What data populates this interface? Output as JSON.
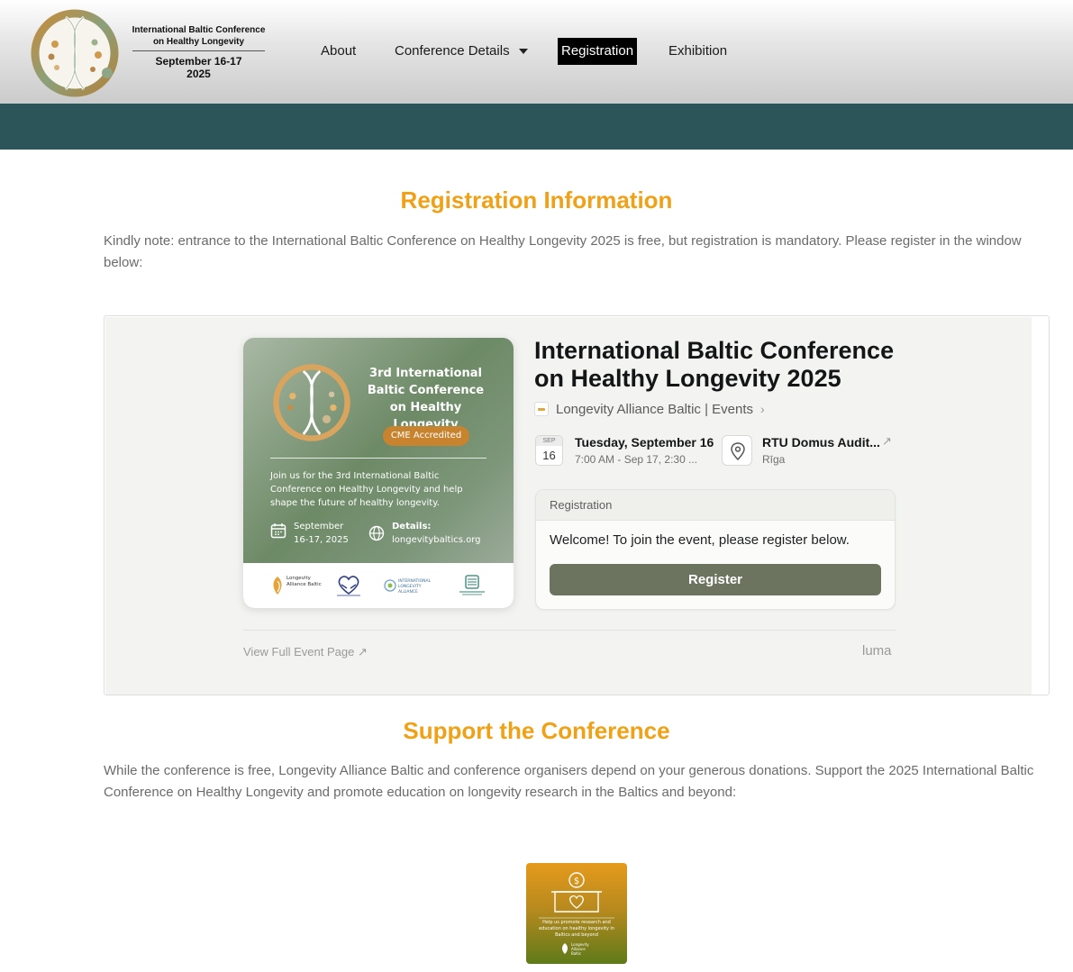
{
  "header": {
    "logo_title_line1": "International Baltic Conference",
    "logo_title_line2": "on Healthy Longevity",
    "logo_date_line1": "September 16-17",
    "logo_date_line2": "2025",
    "nav": {
      "about": "About",
      "conference_details": "Conference Details",
      "registration": "Registration",
      "exhibition": "Exhibition"
    }
  },
  "registration_section": {
    "title": "Registration Information",
    "note": "Kindly note: entrance to the International Baltic Conference on Healthy Longevity 2025 is free, but registration is mandatory. Please register in the window below:"
  },
  "event_embed": {
    "poster": {
      "heading_line1": "3rd International",
      "heading_line2": "Baltic Conference",
      "heading_line3": "on Healthy Longevity",
      "badge": "CME Accredited",
      "body": "Join us for the 3rd International Baltic Conference on Healthy Longevity and help shape the future of healthy longevity.",
      "date_line1": "September",
      "date_line2": "16-17, 2025",
      "details_line1": "Details:",
      "details_line2": "longevitybaltics.org",
      "partners": {
        "lab": "Longevity Alliance Baltic",
        "international": "INTERNATIONAL LONGEVITY ALLIANCE"
      }
    },
    "title_line1": "International Baltic Conference",
    "title_line2": "on Healthy Longevity 2025",
    "host": "Longevity Alliance Baltic | Events",
    "date_box_month": "SEP",
    "date_box_day": "16",
    "date_main": "Tuesday, September 16",
    "date_sub": "7:00 AM - Sep 17, 2:30 ...",
    "location_main": "RTU Domus Audit...",
    "location_sub": "Rīga",
    "registration_card": {
      "header": "Registration",
      "welcome": "Welcome! To join the event, please register below.",
      "button": "Register"
    },
    "view_full": "View Full Event Page ↗",
    "brand": "luma"
  },
  "support_section": {
    "title": "Support the Conference",
    "text": "While the conference is free, Longevity Alliance Baltic and conference organisers depend on your generous donations. Support the 2025 International Baltic Conference on Healthy Longevity and promote education on longevity research in the Baltics and beyond:",
    "donate_tile_text": "Help us promote research and education on healthy longevity in Baltics and beyond",
    "donate_brand_line1": "Longevity",
    "donate_brand_line2": "Alliance",
    "donate_brand_line3": "Baltic"
  },
  "colors": {
    "accent_orange": "#f0a116",
    "teal_bar": "#2b5558",
    "register_button": "#6c7460"
  }
}
